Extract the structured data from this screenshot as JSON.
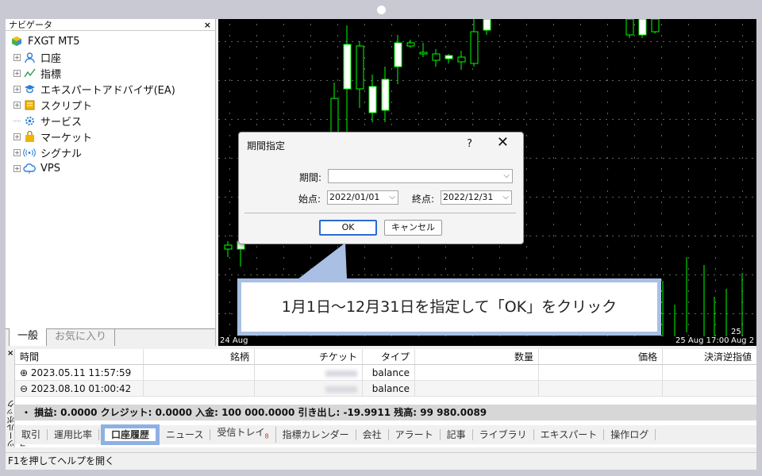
{
  "navigator": {
    "title": "ナビゲータ",
    "close": "×",
    "root": "FXGT MT5",
    "items": [
      {
        "label": "口座",
        "icon": "accounts-icon",
        "expandable": true
      },
      {
        "label": "指標",
        "icon": "indicators-icon",
        "expandable": true
      },
      {
        "label": "エキスパートアドバイザ(EA)",
        "icon": "expert-advisor-icon",
        "expandable": true
      },
      {
        "label": "スクリプト",
        "icon": "script-icon",
        "expandable": true
      },
      {
        "label": "サービス",
        "icon": "services-icon",
        "expandable": false
      },
      {
        "label": "マーケット",
        "icon": "market-icon",
        "expandable": true
      },
      {
        "label": "シグナル",
        "icon": "signals-icon",
        "expandable": true
      },
      {
        "label": "VPS",
        "icon": "vps-cloud-icon",
        "expandable": true
      }
    ],
    "tabs": [
      "一般",
      "お気に入り"
    ]
  },
  "chart": {
    "x_labels": [
      "24 Aug",
      "25 Aug 17:00",
      "25 Aug 2"
    ],
    "colors": {
      "background": "#000000",
      "bull": "#ffffff",
      "bear": "#000000",
      "outline": "#00ff00",
      "grid": "#5a6a5a"
    }
  },
  "dialog": {
    "title": "期間指定",
    "help": "?",
    "close": "✕",
    "period_label": "期間:",
    "period_value": "",
    "start_label": "始点:",
    "start_value": "2022/01/01",
    "end_label": "終点:",
    "end_value": "2022/12/31",
    "ok": "OK",
    "cancel": "キャンセル"
  },
  "callout": {
    "text": "1月1日～12月31日を指定して「OK」をクリック"
  },
  "toolbox": {
    "side_label": "ツールボックス",
    "close": "×",
    "columns": [
      "時間",
      "銘柄",
      "チケット",
      "タイプ",
      "数量",
      "価格",
      "決済逆指値"
    ],
    "rows": [
      {
        "expander": "⊕",
        "time": "2023.05.11 11:57:59",
        "symbol": "",
        "type": "balance"
      },
      {
        "expander": "⊖",
        "time": "2023.08.10 01:00:42",
        "symbol": "",
        "type": "balance"
      }
    ],
    "summary": "・ 損益: 0.0000  クレジット: 0.0000  入金: 100 000.0000  引き出し: -19.9911  残高: 99 980.0089",
    "tabs": [
      {
        "label": "取引"
      },
      {
        "label": "運用比率"
      },
      {
        "label": "口座履歴",
        "active": true
      },
      {
        "label": "ニュース"
      },
      {
        "label": "受信トレイ",
        "badge": "8"
      },
      {
        "label": "指標カレンダー"
      },
      {
        "label": "会社"
      },
      {
        "label": "アラート"
      },
      {
        "label": "記事"
      },
      {
        "label": "ライブラリ"
      },
      {
        "label": "エキスパート"
      },
      {
        "label": "操作ログ"
      }
    ]
  },
  "statusbar": {
    "text": "F1を押してヘルプを開く"
  },
  "accent": {
    "highlight": "#7fa2d9",
    "callout_border": "#a9bfe4",
    "ok_border": "#2c6bd1"
  }
}
